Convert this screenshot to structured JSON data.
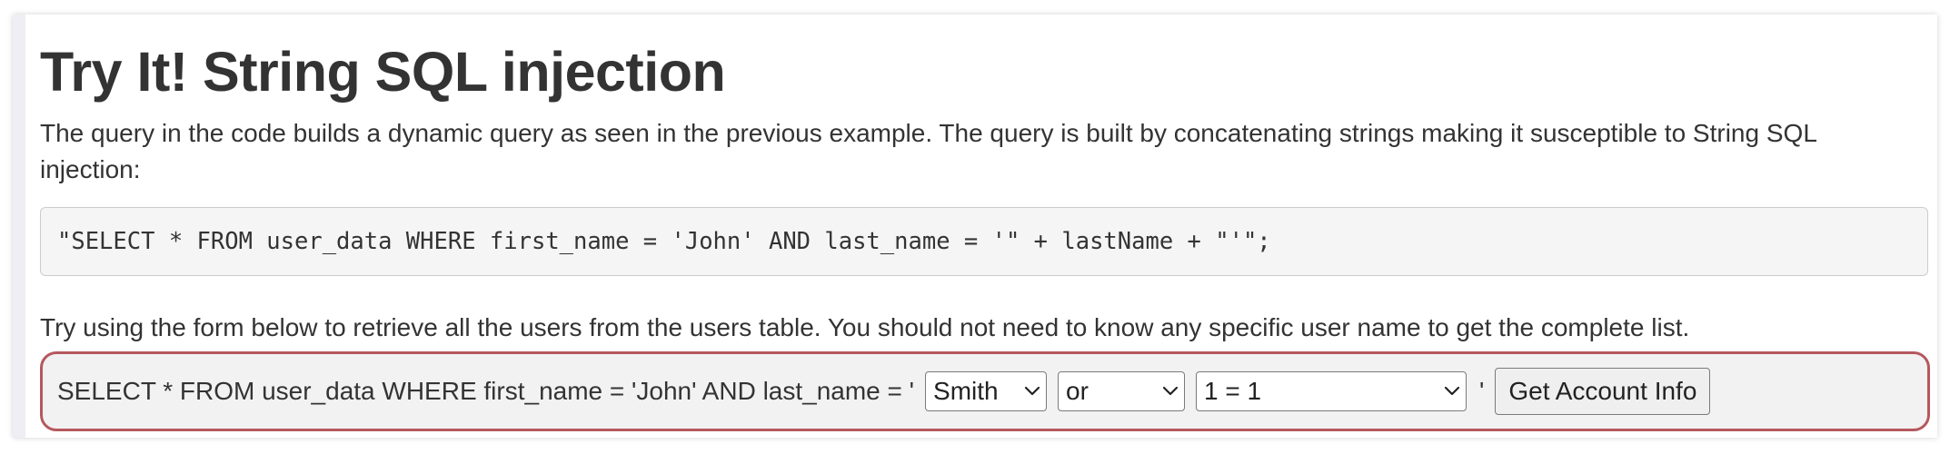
{
  "lesson": {
    "title": "Try It! String SQL injection",
    "intro": "The query in the code builds a dynamic query as seen in the previous example. The query is built by concatenating strings making it susceptible to String SQL injection:",
    "code": "\"SELECT * FROM user_data WHERE first_name = 'John' AND last_name = '\" + lastName + \"'\";",
    "instructions": "Try using the form below to retrieve all the users from the users table. You should not need to know any specific user name to get the complete list."
  },
  "form": {
    "query_prefix": "SELECT * FROM user_data WHERE first_name = 'John' AND last_name = '",
    "last_name_select": "Smith",
    "operator_select": "or",
    "condition_select": "1 = 1",
    "closing_quote": "'",
    "submit_label": "Get Account Info"
  },
  "icons": {
    "select_chevron": "chevron-down-icon"
  },
  "colors": {
    "form_border": "#b5585d",
    "code_background": "#f5f5f5",
    "text": "#333333"
  }
}
